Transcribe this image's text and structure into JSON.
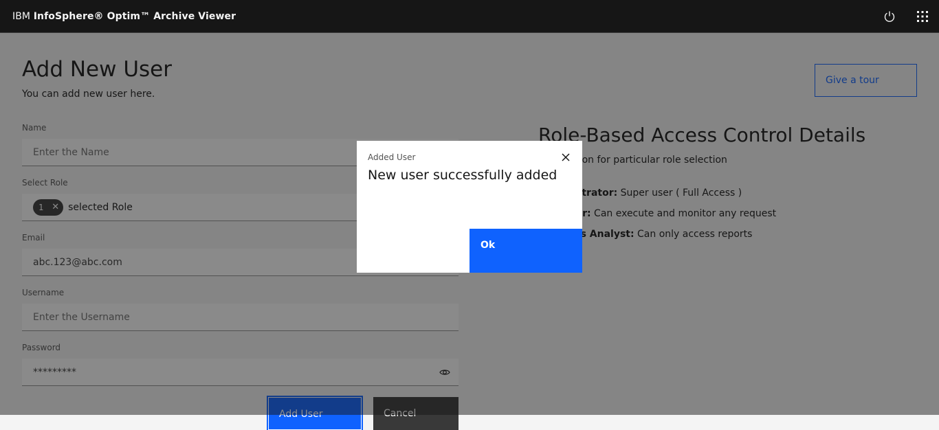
{
  "header": {
    "brand_prefix": "IBM",
    "brand_name": "InfoSphere® Optim™ Archive Viewer",
    "icons": [
      "power-icon",
      "app-switcher-icon"
    ]
  },
  "page": {
    "title": "Add New User",
    "subtitle": "You can add new user here.",
    "tour_label": "Give a tour"
  },
  "form": {
    "name_label": "Name",
    "name_placeholder": "Enter the Name",
    "role_label": "Select Role",
    "role_count": "1",
    "role_text": "selected Role",
    "email_label": "Email",
    "email_value": "abc.123@abc.com",
    "username_label": "Username",
    "username_placeholder": "Enter the Username",
    "password_label": "Password",
    "password_value": "*********",
    "add_label": "Add User",
    "cancel_label": "Cancel"
  },
  "rbac": {
    "title": "Role-Based Access Control Details",
    "subtitle": "Information for particular role selection",
    "roles": [
      {
        "role": "Administrator:",
        "desc": " Super user ( Full Access )"
      },
      {
        "role": "Operator:",
        "desc": " Can execute and monitor any request"
      },
      {
        "role": "Business Analyst:",
        "desc": " Can only access reports"
      }
    ]
  },
  "modal": {
    "label": "Added User",
    "heading": "New user successfully added",
    "ok_label": "Ok"
  },
  "colors": {
    "accent": "#0f62fe",
    "header_bg": "#161616",
    "overlay": "rgba(22,22,22,0.5)"
  }
}
